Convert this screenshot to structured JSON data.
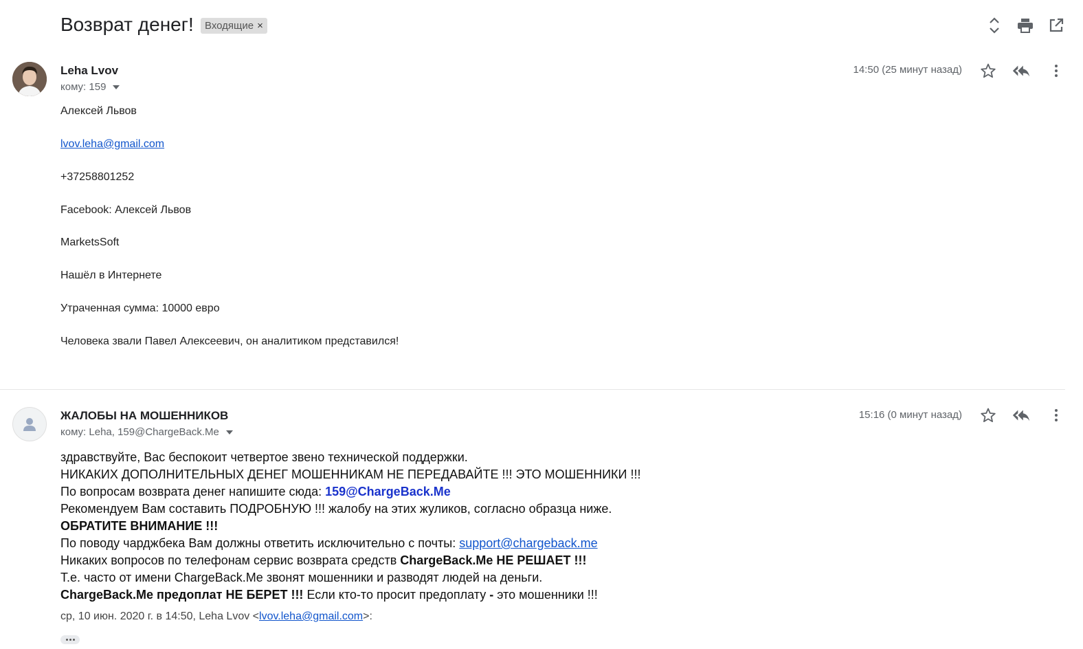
{
  "header": {
    "subject": "Возврат денег!",
    "label": "Входящие",
    "label_close": "×",
    "icons": [
      "expand-collapse-icon",
      "print-icon",
      "open-in-new-window-icon"
    ]
  },
  "messages": [
    {
      "sender": "Leha Lvov",
      "to": "кому: 159",
      "time": "14:50 (25 минут назад)",
      "avatar": "photo",
      "body": [
        "Алексей Львов",
        "lvov.leha@gmail.com",
        "+37258801252",
        "Facebook: Алексей Львов",
        "MarketsSoft",
        "Нашёл в Интернете",
        "Утраченная сумма: 10000 евро",
        "Человека звали Павел Алексеевич, он аналитиком представился!"
      ]
    },
    {
      "sender": "ЖАЛОБЫ НА МОШЕННИКОВ",
      "to": "кому: Leha, 159@ChargeBack.Me",
      "time": "15:16 (0 минут назад)",
      "avatar": "default",
      "body": {
        "l1": "здравствуйте, Вас беспокоит четвертое звено технической поддержки.",
        "l2": "НИКАКИХ ДОПОЛНИТЕЛЬНЫХ ДЕНЕГ МОШЕННИКАМ НЕ ПЕРЕДАВАЙТЕ !!! ЭТО МОШЕННИКИ !!!",
        "l3_pre": "По вопросам возврата денег напишите сюда: ",
        "l3_link": "159@ChargeBack.Me",
        "l4": "Рекомендуем Вам составить ПОДРОБНУЮ !!! жалобу на этих жуликов, согласно образца ниже.",
        "l5": "ОБРАТИТЕ ВНИМАНИЕ !!!",
        "l6_pre": "По поводу чарджбека Вам должны ответить исключительно с почты: ",
        "l6_link": "support@chargeback.me",
        "l7_pre": "Никаких вопросов по телефонам сервис возврата средств ",
        "l7_bold": "ChargeBack.Me НЕ РЕШАЕТ !!!",
        "l8": "Т.е. часто от имени ChargeBack.Me звонят мошенники и разводят людей на деньги.",
        "l9_bold": "ChargeBack.Me предоплат НЕ БЕРЕТ !!!",
        "l9_mid": " Если кто-то просит предоплату ",
        "l9_dash": "-",
        "l9_end": " это мошенники !!!"
      },
      "quote": {
        "pre": "ср, 10 июн. 2020 г. в 14:50, Leha Lvov <",
        "link": "lvov.leha@gmail.com",
        "post": ">:"
      }
    }
  ],
  "colors": {
    "link": "#1155cc",
    "bold_link": "#1a33cc",
    "muted": "#5f6368",
    "label_bg": "#dddddd"
  }
}
